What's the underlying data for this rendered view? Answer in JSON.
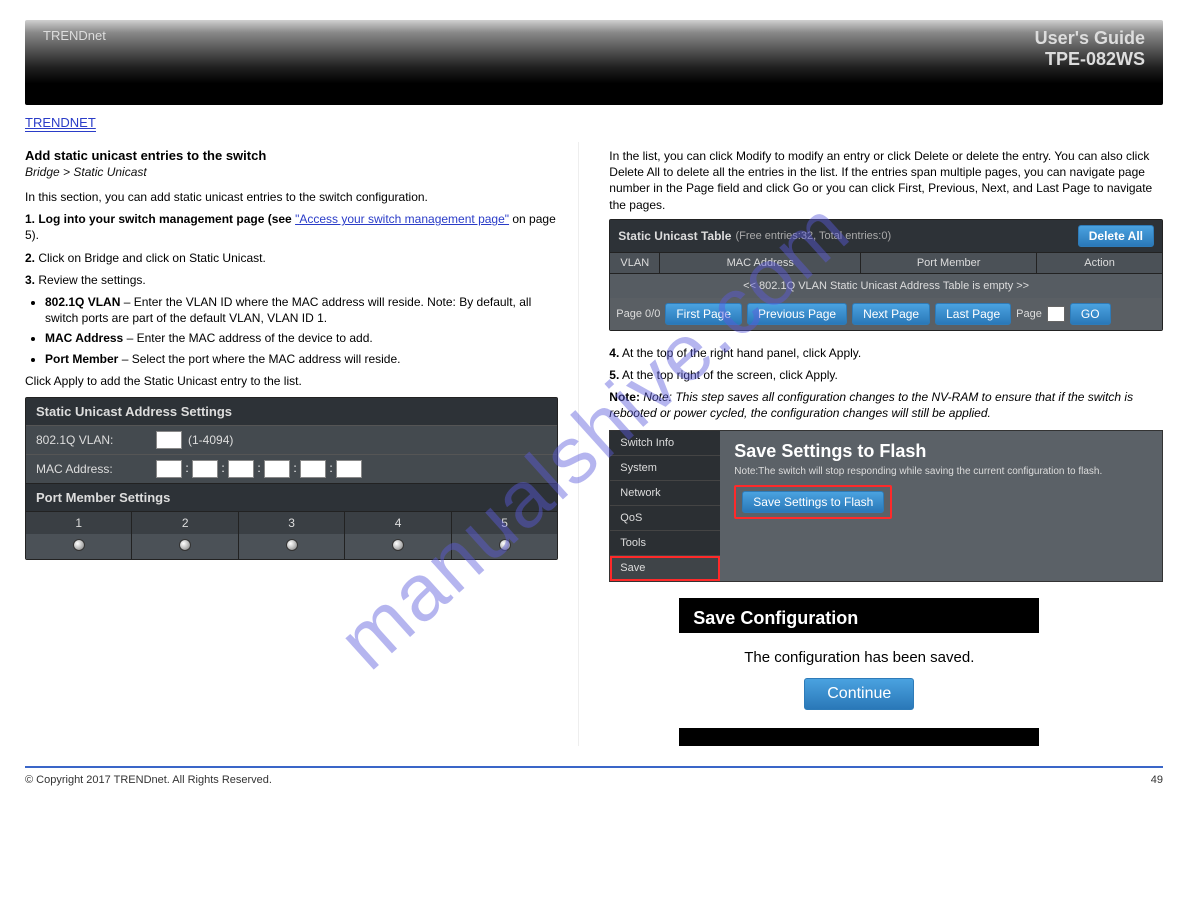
{
  "header": {
    "brand": "TRENDnet",
    "guide": "User's Guide",
    "model": "TPE-082WS"
  },
  "brand_link": "TRENDNET",
  "left": {
    "title": "Add static unicast entries to the switch",
    "navpath_prefix": "Bridge > Static Unicast",
    "intro": "In this section, you can add static unicast entries to the switch configuration.",
    "step1": "1. Log into your switch management page (see ",
    "step1_link": "\"Access your switch management page\"",
    "step1_after": " on page 5).",
    "step2_label": "2.",
    "step2_text": " Click on Bridge and click on Static Unicast.",
    "step3_label": "3.",
    "step3_text": " Review the settings.",
    "bullets": [
      {
        "bold": "802.1Q VLAN",
        "text": " – Enter the VLAN ID where the MAC address will reside. Note: By default, all switch ports are part of the default VLAN, VLAN ID 1."
      },
      {
        "bold": "MAC Address",
        "text": " – Enter the MAC address of the device to add."
      },
      {
        "bold": "Port Member",
        "text": " – Select the port where the MAC address will reside."
      }
    ],
    "apply": "Click Apply to add the Static Unicast entry to the list.",
    "panel": {
      "title": "Static Unicast Address Settings",
      "vlan_label": "802.1Q VLAN:",
      "vlan_range": "(1-4094)",
      "mac_label": "MAC Address:",
      "pm_title": "Port Member Settings",
      "ports": [
        "1",
        "2",
        "3",
        "4",
        "5"
      ]
    }
  },
  "right": {
    "intro": "In the list, you can click Modify to modify an entry or click Delete or delete the entry. You can also click Delete All to delete all the entries in the list. If the entries span multiple pages, you can navigate page number in the Page field and click Go or you can click First, Previous, Next, and Last Page to navigate the pages.",
    "table": {
      "title": "Static Unicast Table",
      "meta": "(Free entries:32, Total entries:0)",
      "delete_all": "Delete All",
      "cols": {
        "vlan": "VLAN",
        "mac": "MAC Address",
        "port": "Port Member",
        "action": "Action"
      },
      "empty": "<< 802.1Q VLAN Static Unicast Address Table is empty >>",
      "page_label": "Page 0/0",
      "first": "First Page",
      "prev": "Previous Page",
      "next": "Next Page",
      "last": "Last Page",
      "page_word": "Page",
      "go": "GO"
    },
    "step4_label": "4.",
    "step4_text": " At the top of the right hand panel, click Apply.",
    "step5_label": "5.",
    "step5_text": " At the top right of the screen, click Apply.",
    "note5": "Note: This step saves all configuration changes to the NV-RAM to ensure that if the switch is rebooted or power cycled, the configuration changes will still be applied.",
    "ss": {
      "nav": [
        "Switch Info",
        "System",
        "Network",
        "QoS",
        "Tools",
        "Save"
      ],
      "title": "Save Settings to Flash",
      "note": "Note:The switch will stop responding while saving the current configuration to flash.",
      "btn": "Save Settings to Flash"
    },
    "conf": {
      "title": "Save Configuration",
      "msg": "The configuration has been saved.",
      "btn": "Continue"
    }
  },
  "footer": {
    "left": "© Copyright 2017 TRENDnet. All Rights Reserved.",
    "right": "49"
  },
  "watermark": "manualshive.com"
}
